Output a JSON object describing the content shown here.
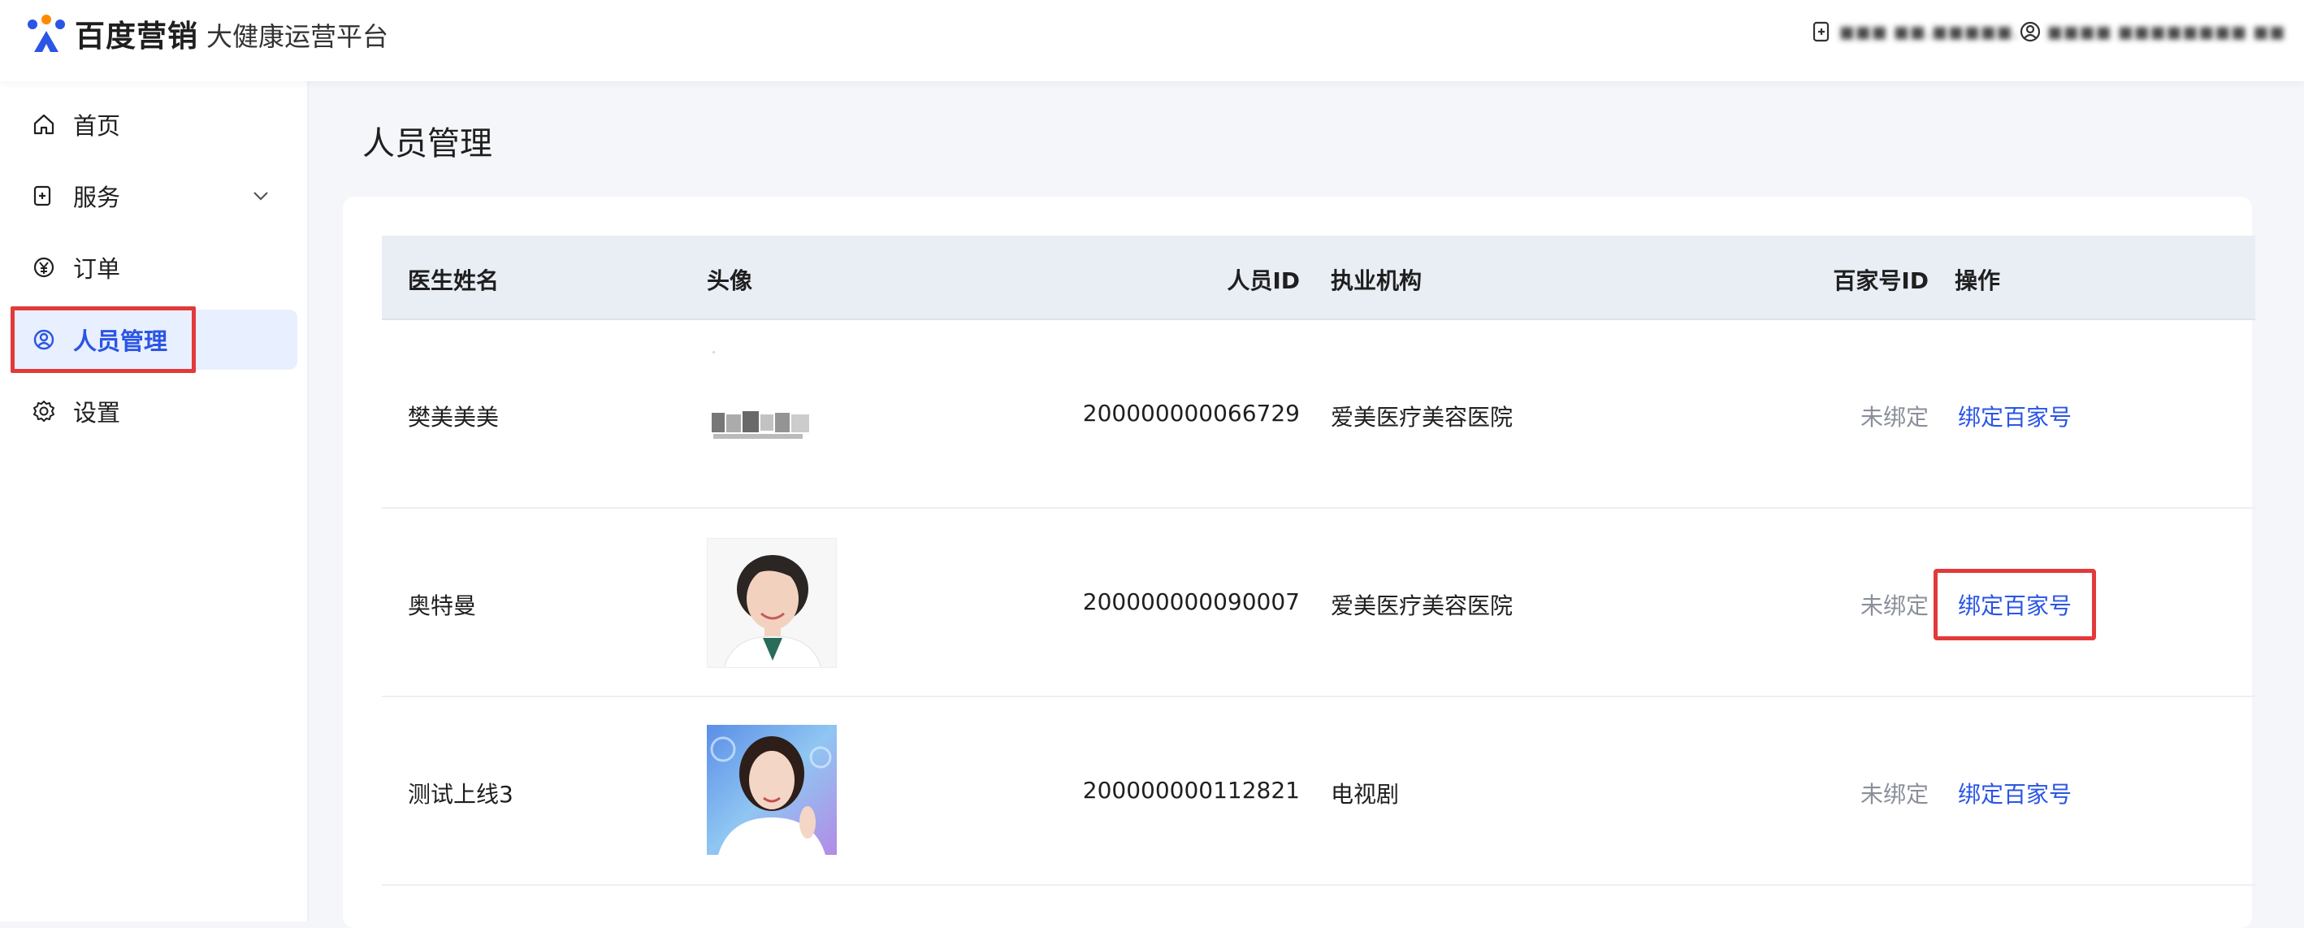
{
  "header": {
    "brand": "百度营销",
    "platform": "大健康运营平台",
    "account_text": "■■■ ■■.■■■■■.",
    "user_text": "■■■■ ■■■■■■■■ ■■"
  },
  "sidebar": {
    "items": [
      {
        "label": "首页",
        "icon": "home-icon"
      },
      {
        "label": "服务",
        "icon": "service-icon",
        "expandable": true
      },
      {
        "label": "订单",
        "icon": "yuan-icon"
      },
      {
        "label": "人员管理",
        "icon": "person-circle-icon",
        "active": true
      },
      {
        "label": "设置",
        "icon": "gear-icon"
      }
    ]
  },
  "page": {
    "title": "人员管理"
  },
  "table": {
    "columns": [
      "医生姓名",
      "头像",
      "人员ID",
      "执业机构",
      "百家号ID",
      "操作"
    ],
    "rows": [
      {
        "name": "樊美美美",
        "avatar": "blurred-image",
        "id": "200000000066729",
        "org": "爱美医疗美容医院",
        "bjh_status": "未绑定",
        "action": "绑定百家号"
      },
      {
        "name": "奥特曼",
        "avatar": "doctor-portrait-woman-short-hair",
        "id": "200000000090007",
        "org": "爱美医疗美容医院",
        "bjh_status": "未绑定",
        "action": "绑定百家号"
      },
      {
        "name": "测试上线3",
        "avatar": "doctor-portrait-woman-blue-bg",
        "id": "200000000112821",
        "org": "电视剧",
        "bjh_status": "未绑定",
        "action": "绑定百家号"
      }
    ]
  },
  "colors": {
    "accent": "#2a55e5",
    "highlight": "#e23a3a",
    "header_bg": "#e9edf4"
  }
}
